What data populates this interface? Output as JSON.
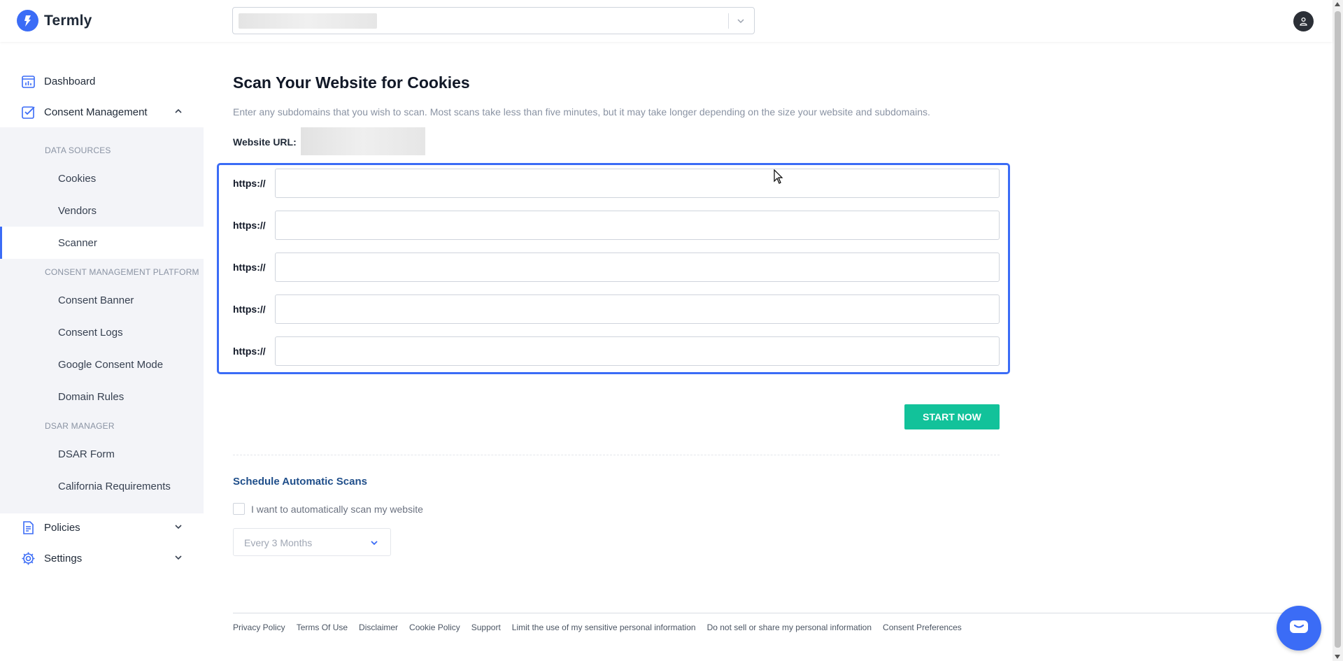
{
  "app": {
    "name": "Termly",
    "accent": "#3b6cf6",
    "start_color": "#12c29a"
  },
  "header": {
    "site_selector_icon": "chevron-down-icon",
    "avatar_icon": "user-icon"
  },
  "sidebar": {
    "dashboard": "Dashboard",
    "consent_management": "Consent Management",
    "data_sources": "DATA SOURCES",
    "cookies": "Cookies",
    "vendors": "Vendors",
    "scanner": "Scanner",
    "cmp": "CONSENT MANAGEMENT PLATFORM",
    "consent_banner": "Consent Banner",
    "consent_logs": "Consent Logs",
    "google_consent_mode": "Google Consent Mode",
    "domain_rules": "Domain Rules",
    "dsar_manager": "DSAR MANAGER",
    "dsar_form": "DSAR Form",
    "california": "California Requirements",
    "policies": "Policies",
    "settings": "Settings"
  },
  "main": {
    "title": "Scan Your Website for Cookies",
    "description": "Enter any subdomains that you wish to scan. Most scans take less than five minutes, but it may take longer depending on the size your website and subdomains.",
    "website_url_label": "Website URL:",
    "subdomains": [
      {
        "prefix": "https://",
        "value": ""
      },
      {
        "prefix": "https://",
        "value": ""
      },
      {
        "prefix": "https://",
        "value": ""
      },
      {
        "prefix": "https://",
        "value": ""
      },
      {
        "prefix": "https://",
        "value": ""
      }
    ],
    "start_button": "START NOW",
    "schedule_title": "Schedule Automatic Scans",
    "schedule_checkbox": "I want to automatically scan my website",
    "frequency_value": "Every 3 Months"
  },
  "footer": {
    "links": [
      "Privacy Policy",
      "Terms Of Use",
      "Disclaimer",
      "Cookie Policy",
      "Support",
      "Limit the use of my sensitive personal information",
      "Do not sell or share my personal information",
      "Consent Preferences"
    ]
  }
}
